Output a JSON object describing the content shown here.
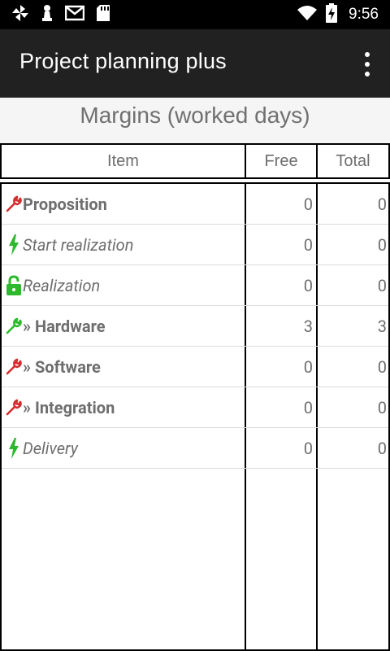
{
  "status_bar": {
    "time": "9:56",
    "left_icons": [
      "pinwheel-icon",
      "chess-pawn-icon",
      "gmail-icon",
      "sd-card-icon"
    ],
    "right_icons": [
      "wifi-icon",
      "battery-charging-icon"
    ]
  },
  "app_bar": {
    "title": "Project planning plus",
    "menu_icon": "overflow-menu-icon"
  },
  "heading": "Margins (worked days)",
  "table": {
    "columns": [
      "Item",
      "Free",
      "Total"
    ],
    "rows": [
      {
        "icon": "wrench-icon",
        "icon_color": "#d32f2f",
        "label": "Proposition",
        "style": "bold",
        "free": "0",
        "total": "0"
      },
      {
        "icon": "lightning-icon",
        "icon_color": "#2eb82e",
        "label": "Start realization",
        "style": "italic",
        "free": "0",
        "total": "0"
      },
      {
        "icon": "lock-icon",
        "icon_color": "#2eb82e",
        "label": "Realization",
        "style": "italic",
        "free": "0",
        "total": "0"
      },
      {
        "icon": "wrench-icon",
        "icon_color": "#2eb82e",
        "label": "» Hardware",
        "style": "bold",
        "free": "3",
        "total": "3"
      },
      {
        "icon": "wrench-icon",
        "icon_color": "#d32f2f",
        "label": "» Software",
        "style": "bold",
        "free": "0",
        "total": "0"
      },
      {
        "icon": "wrench-icon",
        "icon_color": "#d32f2f",
        "label": "» Integration",
        "style": "bold",
        "free": "0",
        "total": "0"
      },
      {
        "icon": "lightning-icon",
        "icon_color": "#2eb82e",
        "label": "Delivery",
        "style": "italic",
        "free": "0",
        "total": "0"
      }
    ]
  },
  "colors": {
    "app_bar": "#212121",
    "status_bar": "#000000",
    "text_gray": "#6e6e6e",
    "heading_bg": "#f5f5f5"
  }
}
